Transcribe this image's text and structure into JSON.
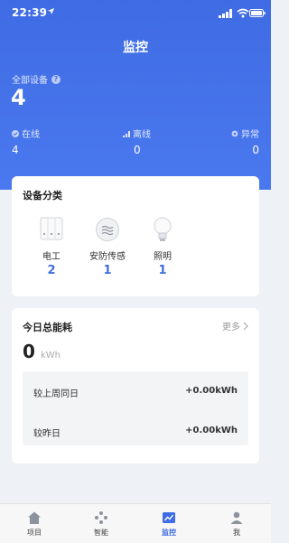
{
  "status": {
    "time": "22:39"
  },
  "header": {
    "title": "监控",
    "all_devices_label": "全部设备",
    "all_devices_count": "4"
  },
  "stats": {
    "online": {
      "label": "在线",
      "value": "4"
    },
    "offline": {
      "label": "离线",
      "value": "0"
    },
    "abnormal": {
      "label": "异常",
      "value": "0"
    }
  },
  "category": {
    "title": "设备分类",
    "items": [
      {
        "name": "电工",
        "count": "2",
        "icon": "electrician-switch-icon"
      },
      {
        "name": "安防传感",
        "count": "1",
        "icon": "security-sensor-icon"
      },
      {
        "name": "照明",
        "count": "1",
        "icon": "lightbulb-icon"
      }
    ]
  },
  "energy": {
    "title": "今日总能耗",
    "more": "更多",
    "value": "0",
    "unit": "kWh",
    "compare": [
      {
        "label": "较上周同日",
        "value": "+0.00kWh"
      },
      {
        "label": "较昨日",
        "value": "+0.00kWh"
      }
    ]
  },
  "nav": {
    "items": [
      {
        "label": "项目",
        "icon": "home-icon"
      },
      {
        "label": "智能",
        "icon": "smart-icon"
      },
      {
        "label": "监控",
        "icon": "monitor-chart-icon"
      },
      {
        "label": "我",
        "icon": "user-icon"
      }
    ],
    "active": "监控"
  },
  "colors": {
    "primary": "#3f6ce4",
    "background": "#eef1f6"
  }
}
